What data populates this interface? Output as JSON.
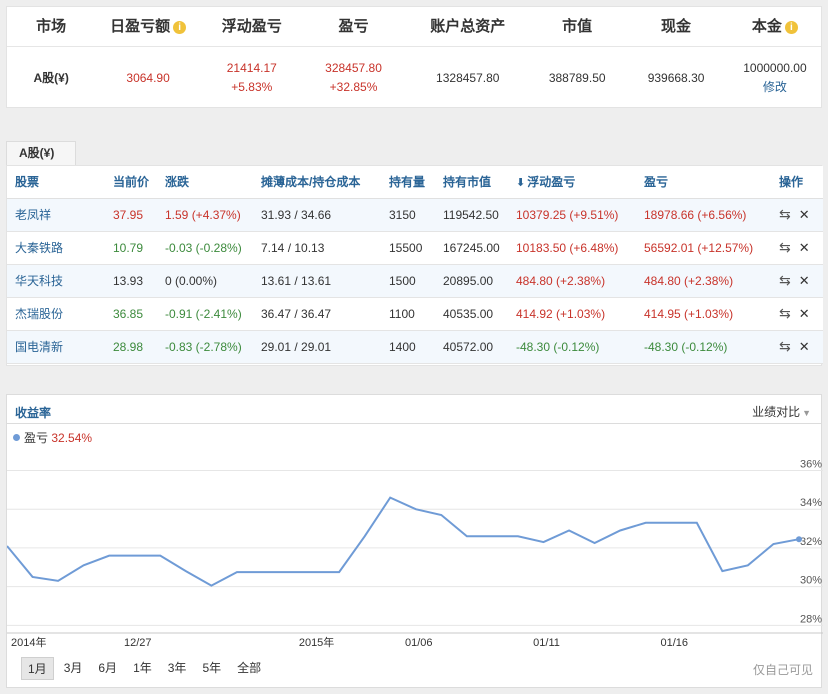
{
  "summary": {
    "headers": {
      "market": "市场",
      "daily_pl": "日盈亏额",
      "floating_pl": "浮动盈亏",
      "pl": "盈亏",
      "total_assets": "账户总资产",
      "market_value": "市值",
      "cash": "现金",
      "principal": "本金"
    },
    "values": {
      "market": "A股(¥)",
      "daily_pl": "3064.90",
      "floating_pl": "21414.17",
      "floating_pl_pct": "+5.83%",
      "pl": "328457.80",
      "pl_pct": "+32.85%",
      "total_assets": "1328457.80",
      "market_value": "388789.50",
      "cash": "939668.30",
      "principal": "1000000.00",
      "edit_link": "修改"
    }
  },
  "tab": {
    "label": "A股(¥)"
  },
  "holdings": {
    "headers": [
      "股票",
      "当前价",
      "涨跌",
      "摊薄成本/持仓成本",
      "持有量",
      "持有市值",
      "浮动盈亏",
      "盈亏",
      "操作"
    ],
    "rows": [
      {
        "name": "老凤祥",
        "price": "37.95",
        "change": "1.59 (+4.37%)",
        "cost": "31.93 / 34.66",
        "qty": "3150",
        "mv": "119542.50",
        "fpl": "10379.25 (+9.51%)",
        "pl": "18978.66 (+6.56%)",
        "dir": "up",
        "fdir": "up",
        "pdir": "up"
      },
      {
        "name": "大秦铁路",
        "price": "10.79",
        "change": "-0.03 (-0.28%)",
        "cost": "7.14 / 10.13",
        "qty": "15500",
        "mv": "167245.00",
        "fpl": "10183.50 (+6.48%)",
        "pl": "56592.01 (+12.57%)",
        "dir": "down",
        "fdir": "up",
        "pdir": "up"
      },
      {
        "name": "华天科技",
        "price": "13.93",
        "change": "0 (0.00%)",
        "cost": "13.61 / 13.61",
        "qty": "1500",
        "mv": "20895.00",
        "fpl": "484.80 (+2.38%)",
        "pl": "484.80 (+2.38%)",
        "dir": "flat",
        "fdir": "up",
        "pdir": "up"
      },
      {
        "name": "杰瑞股份",
        "price": "36.85",
        "change": "-0.91 (-2.41%)",
        "cost": "36.47 / 36.47",
        "qty": "1100",
        "mv": "40535.00",
        "fpl": "414.92 (+1.03%)",
        "pl": "414.95 (+1.03%)",
        "dir": "down",
        "fdir": "up",
        "pdir": "up"
      },
      {
        "name": "国电清新",
        "price": "28.98",
        "change": "-0.83 (-2.78%)",
        "cost": "29.01 / 29.01",
        "qty": "1400",
        "mv": "40572.00",
        "fpl": "-48.30 (-0.12%)",
        "pl": "-48.30 (-0.12%)",
        "dir": "down",
        "fdir": "down",
        "pdir": "down"
      }
    ],
    "icons": {
      "sort": "sort-down-arrow-icon",
      "transfer": "transfer-icon",
      "delete": "close-icon"
    }
  },
  "chart": {
    "title": "收益率",
    "compare_label": "业绩对比",
    "legend_label": "盈亏",
    "legend_value": "32.54%",
    "private_label": "仅自己可见",
    "ranges": [
      "1月",
      "3月",
      "6月",
      "1年",
      "3年",
      "5年",
      "全部"
    ],
    "active_range": "1月"
  },
  "chart_data": {
    "type": "line",
    "series": [
      {
        "name": "盈亏",
        "values": [
          32.1,
          30.5,
          30.3,
          31.1,
          31.6,
          31.6,
          31.6,
          30.8,
          30.05,
          30.75,
          30.75,
          30.75,
          30.75,
          30.75,
          32.6,
          34.6,
          34.0,
          33.7,
          32.6,
          32.6,
          32.6,
          32.3,
          32.9,
          32.25,
          32.9,
          33.3,
          33.3,
          33.3,
          30.8,
          31.1,
          32.2,
          32.45
        ]
      }
    ],
    "x_tick_labels": [
      "2014年",
      "12/27",
      "2015年",
      "01/06",
      "01/11",
      "01/16"
    ],
    "y_tick_labels": [
      "28%",
      "30%",
      "32%",
      "34%",
      "36%"
    ],
    "ylim": [
      27.5,
      36.8
    ],
    "grid": true,
    "color": "#6f9bd6"
  }
}
